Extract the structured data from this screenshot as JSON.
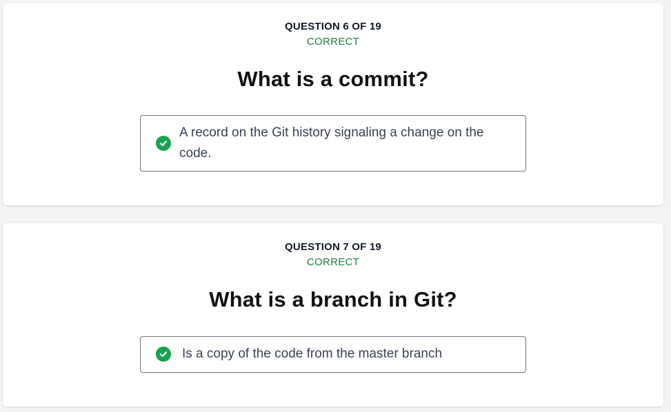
{
  "questions": [
    {
      "counter": "QUESTION 6 OF 19",
      "status": "CORRECT",
      "title": "What is a commit?",
      "answer": "A record on the Git history signaling a change on the code.",
      "answer_icon": "check-circle-icon"
    },
    {
      "counter": "QUESTION 7 OF 19",
      "status": "CORRECT",
      "title": "What is a branch in Git?",
      "answer": "Is a copy of the code from the master branch",
      "answer_icon": "check-circle-icon"
    }
  ],
  "colors": {
    "correct": "#15803d",
    "check_fill": "#16a34a",
    "background": "#f3f4f6",
    "card": "#ffffff"
  }
}
